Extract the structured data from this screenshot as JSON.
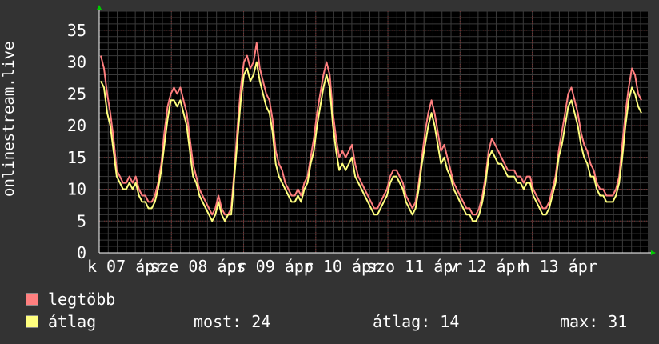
{
  "chart_data": {
    "type": "line",
    "ylabel": "onlinestream.live",
    "ylim": [
      0,
      38
    ],
    "y_ticks": [
      0,
      5,
      10,
      15,
      20,
      25,
      30,
      35
    ],
    "x_tick_labels": [
      "k 07 ápr",
      "sze 08 ápr",
      "cs 09 ápr",
      "p 10 ápr",
      "szo 11 ápr",
      "v 12 ápr",
      "h 13 ápr"
    ],
    "grid": true,
    "series": [
      {
        "name": "legtöbb",
        "color": "#ff7f7f",
        "values": [
          31,
          29,
          25,
          22,
          18,
          13,
          12,
          11,
          11,
          12,
          11,
          12,
          10,
          9,
          9,
          8,
          8,
          9,
          11,
          14,
          19,
          23,
          25,
          26,
          25,
          26,
          24,
          22,
          18,
          14,
          12,
          10,
          9,
          8,
          7,
          6,
          7,
          9,
          7,
          6,
          6,
          7,
          13,
          20,
          26,
          30,
          31,
          29,
          30,
          33,
          29,
          27,
          25,
          24,
          21,
          16,
          14,
          13,
          11,
          10,
          9,
          9,
          10,
          9,
          11,
          12,
          15,
          18,
          22,
          25,
          28,
          30,
          28,
          22,
          18,
          15,
          16,
          15,
          16,
          17,
          14,
          12,
          11,
          10,
          9,
          8,
          7,
          7,
          8,
          9,
          10,
          12,
          13,
          13,
          12,
          11,
          9,
          8,
          7,
          8,
          11,
          15,
          19,
          22,
          24,
          22,
          19,
          16,
          17,
          15,
          13,
          11,
          10,
          9,
          8,
          7,
          7,
          6,
          6,
          7,
          9,
          12,
          16,
          18,
          17,
          16,
          15,
          14,
          13,
          13,
          13,
          12,
          12,
          11,
          12,
          12,
          10,
          9,
          8,
          7,
          7,
          8,
          10,
          12,
          16,
          19,
          22,
          25,
          26,
          24,
          22,
          19,
          17,
          16,
          14,
          13,
          11,
          10,
          10,
          9,
          9,
          9,
          10,
          12,
          17,
          22,
          26,
          29,
          28,
          25,
          24
        ]
      },
      {
        "name": "átlag",
        "color": "#ffff7f",
        "values": [
          27,
          26,
          22,
          20,
          16,
          12,
          11,
          10,
          10,
          11,
          10,
          11,
          9,
          8,
          8,
          7,
          7,
          8,
          10,
          13,
          17,
          21,
          24,
          24,
          23,
          24,
          22,
          20,
          16,
          12,
          11,
          9,
          8,
          7,
          6,
          5,
          6,
          8,
          6,
          5,
          6,
          6,
          12,
          18,
          24,
          28,
          29,
          27,
          28,
          30,
          27,
          25,
          23,
          22,
          19,
          14,
          12,
          11,
          10,
          9,
          8,
          8,
          9,
          8,
          10,
          11,
          14,
          16,
          20,
          23,
          26,
          28,
          26,
          20,
          16,
          13,
          14,
          13,
          14,
          15,
          12,
          11,
          10,
          9,
          8,
          7,
          6,
          6,
          7,
          8,
          9,
          11,
          12,
          12,
          11,
          10,
          8,
          7,
          6,
          7,
          10,
          14,
          17,
          20,
          22,
          20,
          17,
          14,
          15,
          13,
          12,
          10,
          9,
          8,
          7,
          6,
          6,
          5,
          5,
          6,
          8,
          11,
          15,
          16,
          15,
          14,
          14,
          13,
          12,
          12,
          12,
          11,
          11,
          10,
          11,
          11,
          9,
          8,
          7,
          6,
          6,
          7,
          9,
          11,
          15,
          17,
          20,
          23,
          24,
          22,
          20,
          17,
          15,
          14,
          12,
          12,
          10,
          9,
          9,
          8,
          8,
          8,
          9,
          11,
          15,
          20,
          24,
          26,
          25,
          23,
          22
        ]
      }
    ]
  },
  "legend": [
    {
      "label": "legtöbb",
      "color": "#ff7f7f"
    },
    {
      "label": "átlag",
      "color": "#ffff7f"
    }
  ],
  "stats": {
    "most_label": "most:",
    "most_value": "24",
    "atlag_label": "átlag:",
    "atlag_value": "14",
    "max_label": "max:",
    "max_value": "31"
  }
}
